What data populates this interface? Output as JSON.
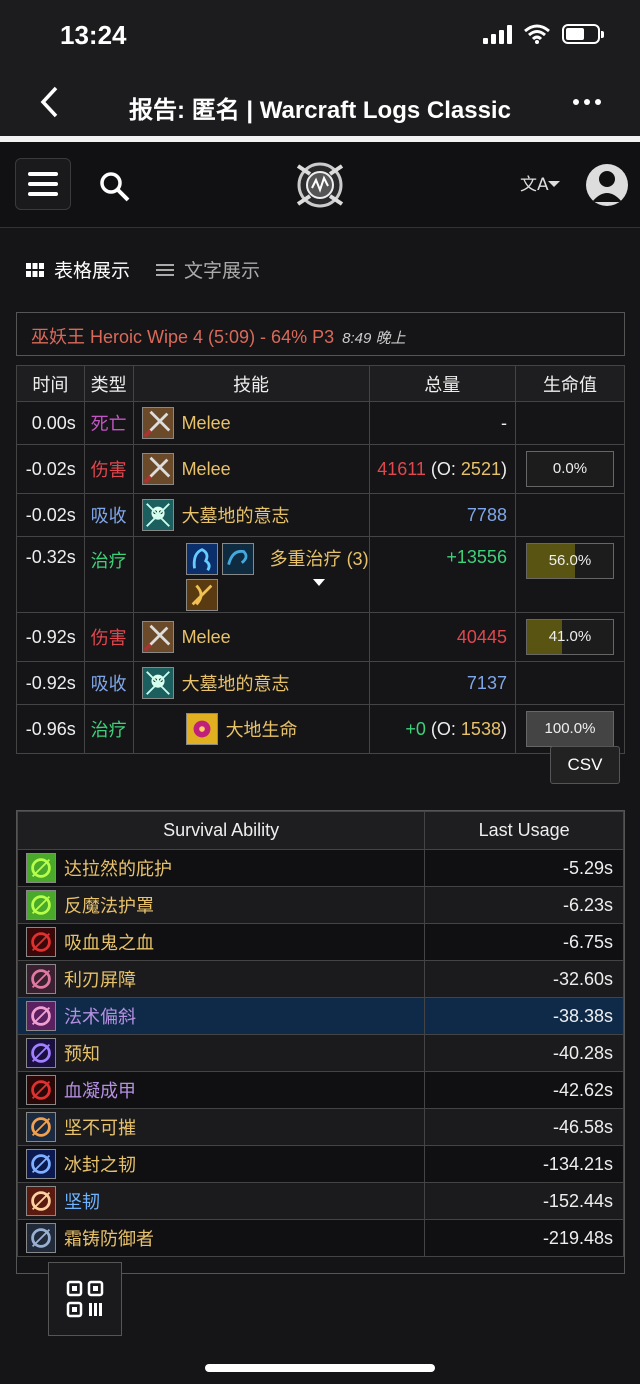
{
  "status": {
    "time": "13:24"
  },
  "appbar": {
    "title": "报告: 匿名 | Warcraft Logs Classic"
  },
  "views": {
    "table": "表格展示",
    "text": "文字展示"
  },
  "fight": {
    "title": "巫妖王 Heroic Wipe 4 (5:09) - 64% P3",
    "when": "8:49 晚上"
  },
  "events": {
    "headers": [
      "时间",
      "类型",
      "技能",
      "总量",
      "生命值"
    ],
    "rows": [
      {
        "time": "0.00s",
        "type": "死亡",
        "ability": "Melee",
        "amount": "-",
        "overheal": "",
        "hp": ""
      },
      {
        "time": "-0.02s",
        "type": "伤害",
        "ability": "Melee",
        "amount": "41611",
        "overheal": "2521",
        "hp": "0.0%"
      },
      {
        "time": "-0.02s",
        "type": "吸收",
        "ability": "大墓地的意志",
        "amount": "7788",
        "overheal": "",
        "hp": ""
      },
      {
        "time": "-0.32s",
        "type": "治疗",
        "ability": "多重治疗 (3)",
        "amount": "+13556",
        "overheal": "",
        "hp": "56.0%"
      },
      {
        "time": "-0.92s",
        "type": "伤害",
        "ability": "Melee",
        "amount": "40445",
        "overheal": "",
        "hp": "41.0%"
      },
      {
        "time": "-0.92s",
        "type": "吸收",
        "ability": "大墓地的意志",
        "amount": "7137",
        "overheal": "",
        "hp": ""
      },
      {
        "time": "-0.96s",
        "type": "治疗",
        "ability": "大地生命",
        "amount": "+0",
        "overheal": "1538",
        "hp": "100.0%"
      }
    ],
    "o_prefix": "(O: ",
    "o_suffix": ")"
  },
  "csv_label": "CSV",
  "survival": {
    "headers": [
      "Survival Ability",
      "Last Usage"
    ],
    "rows": [
      {
        "name": "达拉然的庇护",
        "last": "-5.29s",
        "color": "yellow"
      },
      {
        "name": "反魔法护罩",
        "last": "-6.23s",
        "color": "yellow"
      },
      {
        "name": "吸血鬼之血",
        "last": "-6.75s",
        "color": "yellow"
      },
      {
        "name": "利刃屏障",
        "last": "-32.60s",
        "color": "yellow"
      },
      {
        "name": "法术偏斜",
        "last": "-38.38s",
        "color": "purple"
      },
      {
        "name": "预知",
        "last": "-40.28s",
        "color": "yellow"
      },
      {
        "name": "血凝成甲",
        "last": "-42.62s",
        "color": "purple"
      },
      {
        "name": "坚不可摧",
        "last": "-46.58s",
        "color": "yellow"
      },
      {
        "name": "冰封之韧",
        "last": "-134.21s",
        "color": "yellow"
      },
      {
        "name": "坚韧",
        "last": "-152.44s",
        "color": "blue"
      },
      {
        "name": "霜铸防御者",
        "last": "-219.48s",
        "color": "yellow"
      }
    ]
  }
}
